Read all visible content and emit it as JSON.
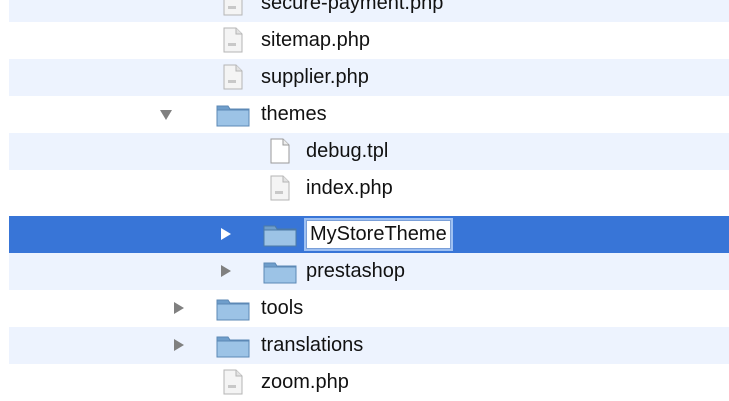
{
  "file_list": {
    "items": [
      {
        "name": "secure-payment.php",
        "kind": "file",
        "icon": "php-file-icon"
      },
      {
        "name": "sitemap.php",
        "kind": "file",
        "icon": "php-file-icon"
      },
      {
        "name": "supplier.php",
        "kind": "file",
        "icon": "php-file-icon"
      },
      {
        "name": "themes",
        "kind": "folder",
        "icon": "folder-icon",
        "expanded": true
      },
      {
        "name": "debug.tpl",
        "kind": "file",
        "icon": "document-icon"
      },
      {
        "name": "index.php",
        "kind": "file",
        "icon": "php-file-icon"
      },
      {
        "name": "MyStoreTheme",
        "kind": "folder",
        "icon": "folder-icon",
        "expanded": false,
        "selected": true,
        "renaming": true
      },
      {
        "name": "prestashop",
        "kind": "folder",
        "icon": "folder-icon",
        "expanded": false
      },
      {
        "name": "tools",
        "kind": "folder",
        "icon": "folder-icon",
        "expanded": false
      },
      {
        "name": "translations",
        "kind": "folder",
        "icon": "folder-icon",
        "expanded": false
      },
      {
        "name": "zoom.php",
        "kind": "file",
        "icon": "php-file-icon"
      }
    ]
  },
  "colors": {
    "selection": "#3875d7",
    "alternate_row": "#edf3fe",
    "folder": "#7eaed8"
  }
}
